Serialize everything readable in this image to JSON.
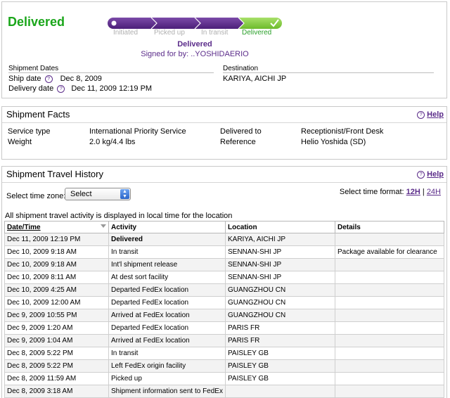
{
  "status": {
    "title": "Delivered",
    "progress_steps": [
      "Initiated",
      "Picked up",
      "In transit",
      "Delivered"
    ],
    "progress_level": 1.0,
    "delivered_label": "Delivered",
    "signed_for": "Signed for by: ..YOSHIDAERIO",
    "shipment_dates_label": "Shipment Dates",
    "ship_date_label": "Ship date",
    "ship_date": "Dec 8, 2009",
    "delivery_date_label": "Delivery date",
    "delivery_date": "Dec 11, 2009 12:19 PM",
    "destination_label": "Destination",
    "destination": "KARIYA, AICHI JP",
    "colors": {
      "status_green": "#1aa61a",
      "brand_purple": "#5b2c8a",
      "progress_done": "#8fd14f"
    }
  },
  "facts": {
    "title": "Shipment Facts",
    "help": "Help",
    "service_type_label": "Service type",
    "service_type": "International Priority Service",
    "weight_label": "Weight",
    "weight": "2.0 kg/4.4 lbs",
    "delivered_to_label": "Delivered to",
    "delivered_to": "Receptionist/Front Desk",
    "reference_label": "Reference",
    "reference": "Helio Yoshida (SD)"
  },
  "history": {
    "title": "Shipment Travel History",
    "help": "Help",
    "time_zone_label": "Select time zone:",
    "time_zone_value": "Select",
    "time_format_label": "Select time format:",
    "format_12h": "12H",
    "format_sep": "|",
    "format_24h": "24H",
    "note": "All shipment travel activity is displayed in local time for the location",
    "columns": [
      "Date/Time",
      "Activity",
      "Location",
      "Details"
    ],
    "rows": [
      [
        "Dec 11, 2009 12:19 PM",
        "Delivered",
        "KARIYA, AICHI JP",
        ""
      ],
      [
        "Dec 10, 2009 9:18 AM",
        "In transit",
        "SENNAN-SHI JP",
        "Package available for clearance"
      ],
      [
        "Dec 10, 2009 9:18 AM",
        "Int'l shipment release",
        "SENNAN-SHI JP",
        ""
      ],
      [
        "Dec 10, 2009 8:11 AM",
        "At dest sort facility",
        "SENNAN-SHI JP",
        ""
      ],
      [
        "Dec 10, 2009 4:25 AM",
        "Departed FedEx location",
        "GUANGZHOU CN",
        ""
      ],
      [
        "Dec 10, 2009 12:00 AM",
        "Departed FedEx location",
        "GUANGZHOU CN",
        ""
      ],
      [
        "Dec 9, 2009 10:55 PM",
        "Arrived at FedEx location",
        "GUANGZHOU CN",
        ""
      ],
      [
        "Dec 9, 2009 1:20 AM",
        "Departed FedEx location",
        "PARIS FR",
        ""
      ],
      [
        "Dec 9, 2009 1:04 AM",
        "Arrived at FedEx location",
        "PARIS FR",
        ""
      ],
      [
        "Dec 8, 2009 5:22 PM",
        "In transit",
        "PAISLEY GB",
        ""
      ],
      [
        "Dec 8, 2009 5:22 PM",
        "Left FedEx origin facility",
        "PAISLEY GB",
        ""
      ],
      [
        "Dec 8, 2009 11:59 AM",
        "Picked up",
        "PAISLEY GB",
        ""
      ],
      [
        "Dec 8, 2009 3:18 AM",
        "Shipment information sent to FedEx",
        "",
        ""
      ]
    ]
  }
}
